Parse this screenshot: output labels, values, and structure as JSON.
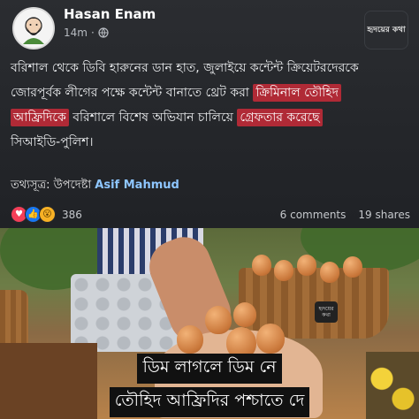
{
  "post": {
    "author": "Hasan Enam",
    "time": "14m",
    "separator": "·",
    "privacy_icon": "globe-icon",
    "page_logo_text": "হৃদয়ের কথা",
    "body_line1": "বরিশাল থেকে ডিবি হারুনের ডান হাত, জুলাইয়ে কন্টেন্ট ক্রিয়েটরদেরকে",
    "body_line2_plain": "জোরপূর্বক লীগের পক্ষে কন্টেন্ট বানাতে থ্রেট করা ",
    "body_line2_hl": "ক্রিমিনাল তৌহিদ",
    "body_line3_hl": "আফ্রিদিকে",
    "body_line3_plain": " বরিশালে বিশেষ অভিযান চালিয়ে ",
    "body_line3_hl2": "গ্রেফতার করেছে",
    "body_line4": "সিআইডি-পুলিশ।",
    "source_label": "তথ্যসূত্র: উপদেষ্টা ",
    "source_name": "Asif Mahmud",
    "reaction_count": "386",
    "comments": "6 comments",
    "shares": "19 shares"
  },
  "image": {
    "caption_line1": "ডিম লাগলে ডিম নে",
    "caption_line2": "তৌহিদ আফ্রিদির পশ্চাতে দে",
    "watermark": "হৃদয়ের কথা"
  },
  "colors": {
    "highlight": "#b02a36",
    "link": "#8ec6ff",
    "background": "#24262a"
  }
}
